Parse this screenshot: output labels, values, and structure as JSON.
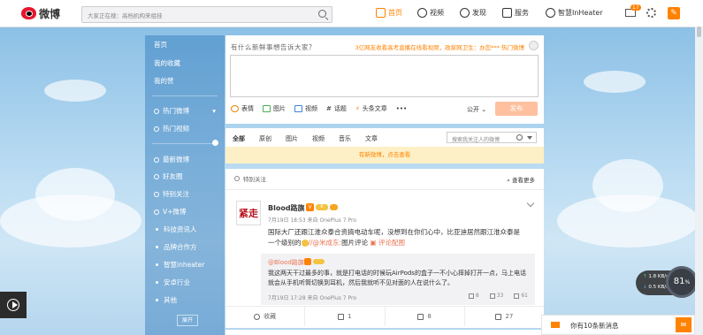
{
  "header": {
    "logo_text": "微博",
    "search_placeholder": "大家正在搜：高档机构来组挂",
    "nav": [
      {
        "label": "首页",
        "icon": "home-icon"
      },
      {
        "label": "视频",
        "icon": "video-icon"
      },
      {
        "label": "发现",
        "icon": "discover-icon"
      },
      {
        "label": "服务",
        "icon": "service-icon"
      },
      {
        "label": "智慧InHeater",
        "icon": "user-icon"
      }
    ],
    "mail_badge": "17",
    "accent": "#ff8200"
  },
  "sidebar": {
    "items": [
      {
        "label": "首页"
      },
      {
        "label": "我的收藏"
      },
      {
        "label": "我的赞"
      },
      {
        "label": "热门微博"
      },
      {
        "label": "热门视频"
      },
      {
        "label": "最新微博"
      },
      {
        "label": "好友圈"
      },
      {
        "label": "特别关注"
      },
      {
        "label": "V+微博"
      },
      {
        "label": "科技资讯人"
      },
      {
        "label": "品牌合作方"
      },
      {
        "label": "智慧inheater"
      },
      {
        "label": "安卓行业"
      },
      {
        "label": "其他"
      }
    ],
    "expand_label": "展开"
  },
  "compose": {
    "hint": "有什么新鲜事想告诉大家？",
    "hot_text": "3亿网友收看高考直播在线看视频，政家网卫生：办您***",
    "hot_link": "热门微博",
    "tools": [
      "表情",
      "图片",
      "视频",
      "话题",
      "头条文章",
      "•••"
    ],
    "visibility": "公开",
    "send_label": "发布"
  },
  "filter": {
    "tabs": [
      "全部",
      "原创",
      "图片",
      "视频",
      "音乐",
      "文章"
    ],
    "search_placeholder": "搜索我关注人的微博",
    "new_notice": "有新微博，点击查看"
  },
  "feed": {
    "header": "特别关注",
    "more": "查看更多",
    "post": {
      "avatar_text": "紧走",
      "user": "Blood路旗",
      "meta": "7月19日 18:53 来自 OnePlus 7 Pro",
      "body_pre": "国际大厂还跟江淮众泰合资搞电动车呢，没想到在你们心中，比亚迪居然跟江淮众泰是一个级别的",
      "body_link": "//@米成东:",
      "body_post": "图片评论",
      "body_link2": "评论配图",
      "repost": {
        "user": "@Blood路旗",
        "text": "我这两天干过最多的事，就是打电话的时候玩AirPods的盒子一不小心摔掉打开一点，马上电话就会从手机听筒切换到耳机，然后我就听不见对面的人在说什么了。",
        "meta": "7月19日 17:28 来自 OnePlus 7 Pro",
        "repost_count": "8",
        "comment_count": "33",
        "like_count": "61"
      },
      "actions": [
        {
          "label": "收藏",
          "icon": "star-icon"
        },
        {
          "label": "1",
          "icon": "repost-icon"
        },
        {
          "label": "8",
          "icon": "comment-icon"
        },
        {
          "label": "27",
          "icon": "like-icon"
        }
      ]
    }
  },
  "widgets": {
    "net_up": "1.8",
    "net_up_unit": "KB/s",
    "net_down": "0.5",
    "net_down_unit": "KB/s",
    "cpu": "81",
    "cpu_unit": "%",
    "message_text": "你有10条新消息"
  }
}
